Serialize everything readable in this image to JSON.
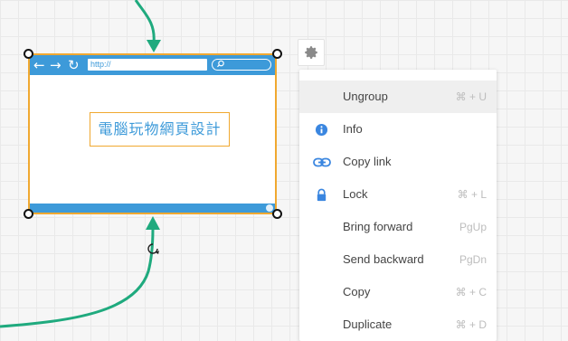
{
  "canvas": {
    "shape": {
      "url_text": "http://",
      "title_text": "電腦玩物網頁設計"
    }
  },
  "context_menu": {
    "items": [
      {
        "id": "ungroup",
        "label": "Ungroup",
        "shortcut": "⌘ + U",
        "icon": "",
        "active": true
      },
      {
        "id": "info",
        "label": "Info",
        "shortcut": "",
        "icon": "info-icon"
      },
      {
        "id": "copy-link",
        "label": "Copy link",
        "shortcut": "",
        "icon": "link-icon"
      },
      {
        "id": "lock",
        "label": "Lock",
        "shortcut": "⌘ + L",
        "icon": "lock-icon"
      },
      {
        "id": "bring-forward",
        "label": "Bring forward",
        "shortcut": "PgUp",
        "icon": ""
      },
      {
        "id": "send-backward",
        "label": "Send backward",
        "shortcut": "PgDn",
        "icon": ""
      },
      {
        "id": "copy",
        "label": "Copy",
        "shortcut": "⌘ + C",
        "icon": ""
      },
      {
        "id": "duplicate",
        "label": "Duplicate",
        "shortcut": "⌘ + D",
        "icon": ""
      }
    ]
  },
  "colors": {
    "connector": "#1faa7e",
    "browser_blue": "#3d9ad9",
    "selection_orange": "#f0a830",
    "icon_blue": "#3a86e0"
  }
}
